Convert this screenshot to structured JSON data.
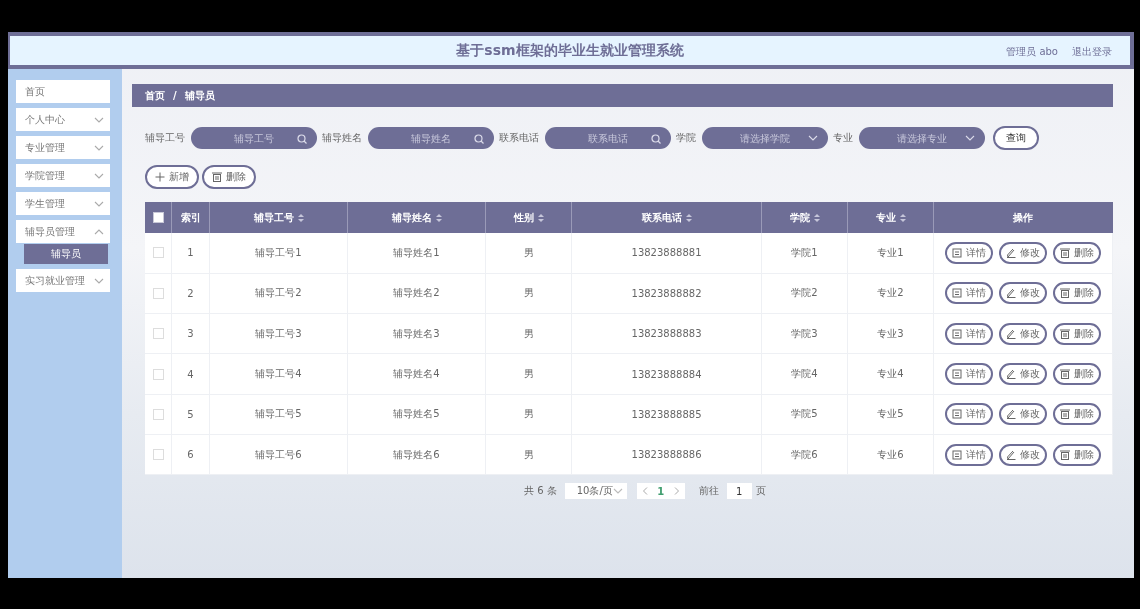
{
  "header": {
    "title": "基于ssm框架的毕业生就业管理系统",
    "user": "管理员 abo",
    "logout": "退出登录"
  },
  "sidebar": {
    "items": [
      {
        "label": "首页"
      },
      {
        "label": "个人中心",
        "expanded": false
      },
      {
        "label": "专业管理",
        "expanded": false
      },
      {
        "label": "学院管理",
        "expanded": false
      },
      {
        "label": "学生管理",
        "expanded": false
      },
      {
        "label": "辅导员管理",
        "expanded": true,
        "children": [
          {
            "label": "辅导员",
            "selected": true
          }
        ]
      },
      {
        "label": "实习就业管理",
        "expanded": false
      }
    ]
  },
  "breadcrumb": {
    "items": [
      "首页",
      "辅导员"
    ],
    "separator": "/"
  },
  "filters": [
    {
      "kind": "search",
      "label": "辅导工号",
      "placeholder": "辅导工号"
    },
    {
      "kind": "search",
      "label": "辅导姓名",
      "placeholder": "辅导姓名"
    },
    {
      "kind": "search",
      "label": "联系电话",
      "placeholder": "联系电话"
    },
    {
      "kind": "select",
      "label": "学院",
      "placeholder": "请选择学院"
    },
    {
      "kind": "select",
      "label": "专业",
      "placeholder": "请选择专业"
    }
  ],
  "query_button": "查询",
  "actions": [
    {
      "kind": "add",
      "label": "新增"
    },
    {
      "kind": "delete",
      "label": "删除"
    }
  ],
  "table": {
    "header_checked": false,
    "columns": [
      {
        "label": "索引",
        "kind": "plain"
      },
      {
        "label": "辅导工号",
        "kind": "sortable"
      },
      {
        "label": "辅导姓名",
        "kind": "sortable"
      },
      {
        "label": "性别",
        "kind": "sortable"
      },
      {
        "label": "联系电话",
        "kind": "sortable"
      },
      {
        "label": "学院",
        "kind": "sortable"
      },
      {
        "label": "专业",
        "kind": "sortable"
      },
      {
        "label": "操作",
        "kind": "plain"
      }
    ],
    "rows": [
      {
        "checked": false,
        "cells": [
          "1",
          "辅导工号1",
          "辅导姓名1",
          "男",
          "13823888881",
          "学院1",
          "专业1"
        ],
        "buttons": [
          {
            "kind": "detail",
            "label": "详情"
          },
          {
            "kind": "edit",
            "label": "修改"
          },
          {
            "kind": "delete",
            "label": "删除"
          }
        ]
      },
      {
        "checked": false,
        "cells": [
          "2",
          "辅导工号2",
          "辅导姓名2",
          "男",
          "13823888882",
          "学院2",
          "专业2"
        ],
        "buttons": [
          {
            "kind": "detail",
            "label": "详情"
          },
          {
            "kind": "edit",
            "label": "修改"
          },
          {
            "kind": "delete",
            "label": "删除"
          }
        ]
      },
      {
        "checked": false,
        "cells": [
          "3",
          "辅导工号3",
          "辅导姓名3",
          "男",
          "13823888883",
          "学院3",
          "专业3"
        ],
        "buttons": [
          {
            "kind": "detail",
            "label": "详情"
          },
          {
            "kind": "edit",
            "label": "修改"
          },
          {
            "kind": "delete",
            "label": "删除"
          }
        ]
      },
      {
        "checked": false,
        "cells": [
          "4",
          "辅导工号4",
          "辅导姓名4",
          "男",
          "13823888884",
          "学院4",
          "专业4"
        ],
        "buttons": [
          {
            "kind": "detail",
            "label": "详情"
          },
          {
            "kind": "edit",
            "label": "修改"
          },
          {
            "kind": "delete",
            "label": "删除"
          }
        ]
      },
      {
        "checked": false,
        "cells": [
          "5",
          "辅导工号5",
          "辅导姓名5",
          "男",
          "13823888885",
          "学院5",
          "专业5"
        ],
        "buttons": [
          {
            "kind": "detail",
            "label": "详情"
          },
          {
            "kind": "edit",
            "label": "修改"
          },
          {
            "kind": "delete",
            "label": "删除"
          }
        ]
      },
      {
        "checked": false,
        "cells": [
          "6",
          "辅导工号6",
          "辅导姓名6",
          "男",
          "13823888886",
          "学院6",
          "专业6"
        ],
        "buttons": [
          {
            "kind": "detail",
            "label": "详情"
          },
          {
            "kind": "edit",
            "label": "修改"
          },
          {
            "kind": "delete",
            "label": "删除"
          }
        ]
      }
    ]
  },
  "pagination": {
    "total": "共 6 条",
    "page_size": "10条/页",
    "pages": [
      {
        "label": "1",
        "selected": true
      }
    ],
    "goto_label": "前往",
    "goto_value": "1",
    "goto_suffix": "页"
  }
}
